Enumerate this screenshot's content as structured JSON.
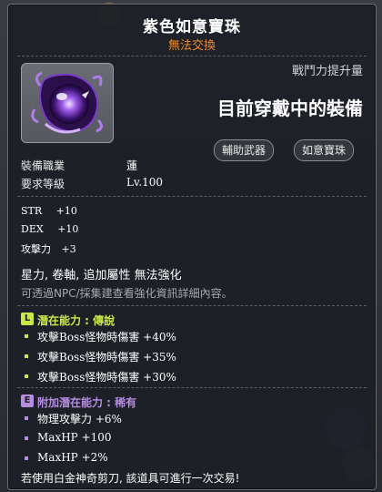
{
  "item": {
    "name": "紫色如意寶珠",
    "trade_status": "無法交換",
    "power_label": "戰鬥力提升量",
    "equip_status": "目前穿戴中的裝備",
    "tags": [
      "輔助武器",
      "如意寶珠"
    ]
  },
  "requirements": {
    "job_label": "裝備職業",
    "job_value": "蓮",
    "level_label": "要求等級",
    "level_value": "Lv.100"
  },
  "stats": [
    {
      "name": "STR",
      "value": "+10"
    },
    {
      "name": "DEX",
      "value": "+10"
    },
    {
      "name": "攻擊力",
      "value": "+3"
    }
  ],
  "properties": "星力, 卷軸, 追加屬性 無法強化",
  "description": "可透過NPC/採集建查看強化資訊詳細內容。",
  "potential": {
    "badge": "L",
    "title": "潛在能力 : 傳說",
    "color": "#c8e84a",
    "lines": [
      "攻擊Boss怪物時傷害 +40%",
      "攻擊Boss怪物時傷害 +35%",
      "攻擊Boss怪物時傷害 +30%"
    ]
  },
  "additional_potential": {
    "badge": "E",
    "title": "附加潛在能力 : 稀有",
    "color": "#b58ce0",
    "lines": [
      "物理攻擊力 +6%",
      "MaxHP +100",
      "MaxHP +2%"
    ]
  },
  "footer": "若使用白金神奇剪刀, 該道具可進行一次交易!"
}
